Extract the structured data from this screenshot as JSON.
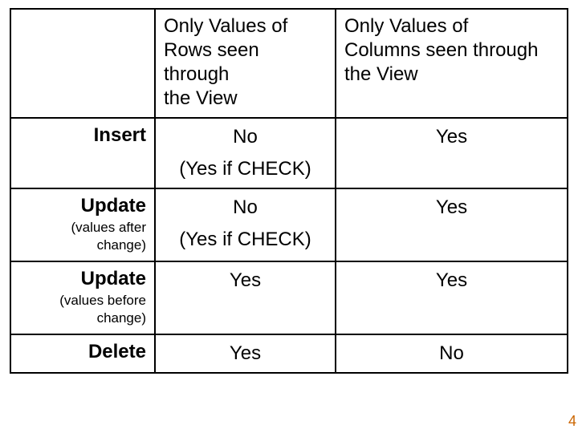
{
  "header": {
    "col1_line1": "Only Values of",
    "col1_line2": "Rows seen through",
    "col1_line3": "the View",
    "col2_line1": "Only Values of",
    "col2_line2": "Columns seen through",
    "col2_line3": "the View"
  },
  "rows": {
    "insert": {
      "label": "Insert",
      "c1_main": "No",
      "c1_sub": "(Yes if CHECK)",
      "c2_main": "Yes"
    },
    "update_after": {
      "label": "Update",
      "sub1": "(values after",
      "sub2": "change)",
      "c1_main": "No",
      "c1_sub": "(Yes if CHECK)",
      "c2_main": "Yes"
    },
    "update_before": {
      "label": "Update",
      "sub1": "(values before",
      "sub2": "change)",
      "c1_main": "Yes",
      "c2_main": "Yes"
    },
    "delete": {
      "label": "Delete",
      "c1_main": "Yes",
      "c2_main": "No"
    }
  },
  "page_number": "4"
}
